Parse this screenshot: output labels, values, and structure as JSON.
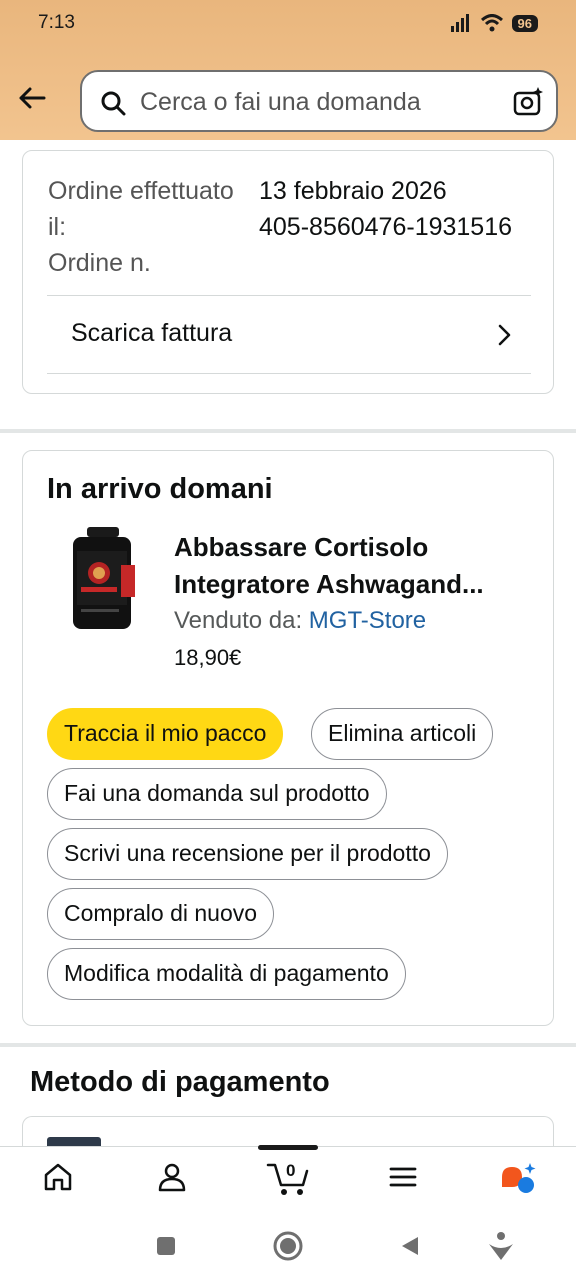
{
  "status_bar": {
    "time": "7:13",
    "battery": "96"
  },
  "search": {
    "placeholder": "Cerca o fai una domanda"
  },
  "order": {
    "date_label": "Ordine effettuato il:",
    "date_value": "13 febbraio 2026",
    "number_label": "Ordine n.",
    "number_value": "405-8560476-1931516",
    "invoice_label": "Scarica fattura"
  },
  "arrival": {
    "title": "In arrivo domani",
    "product": {
      "title_line1": "Abbassare Cortisolo",
      "title_line2": "Integratore Ashwagand...",
      "sold_by_label": "Venduto da: ",
      "seller": "MGT-Store",
      "price": "18,90€"
    },
    "actions": {
      "track": "Traccia il mio pacco",
      "delete": "Elimina articoli",
      "ask": "Fai una domanda sul prodotto",
      "review": "Scrivi una recensione per il prodotto",
      "rebuy": "Compralo di nuovo",
      "payment": "Modifica modalità di pagamento"
    }
  },
  "payment": {
    "title": "Metodo di pagamento"
  },
  "bottom_nav": {
    "cart_count": "0",
    "icons": [
      "home-icon",
      "account-icon",
      "cart-icon",
      "menu-icon",
      "rufus-icon"
    ]
  },
  "colors": {
    "header": "#f2c48f",
    "primary_button": "#ffd814",
    "link": "#2162a1"
  }
}
